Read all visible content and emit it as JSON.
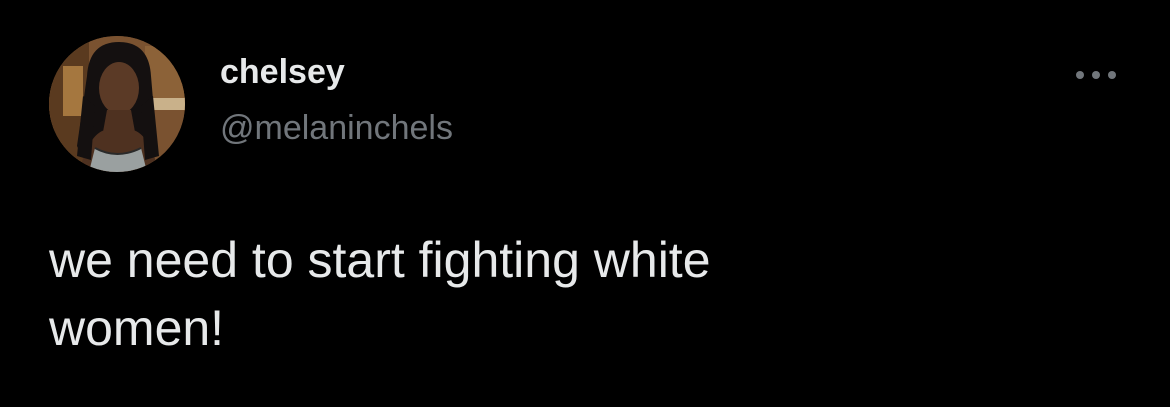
{
  "author": {
    "display_name": "chelsey",
    "handle": "@melaninchels",
    "avatar_icon": "profile-photo"
  },
  "tweet": {
    "text": "we need to start fighting white\nwomen!"
  },
  "actions": {
    "more_icon": "more-horizontal-icon"
  },
  "colors": {
    "background": "#000000",
    "primary_text": "#e7e9ea",
    "secondary_text": "#71767b"
  }
}
